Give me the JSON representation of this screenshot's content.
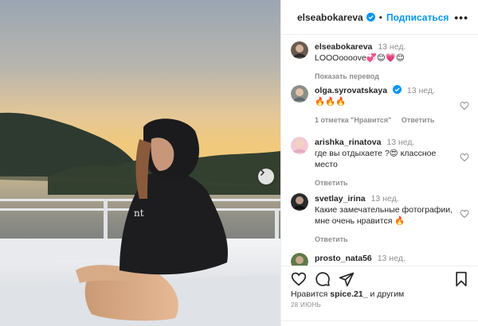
{
  "post": {
    "author": "elseabokareva",
    "follow_label": "Подписаться",
    "dot": "•",
    "more": "•••"
  },
  "comments": [
    {
      "user": "elseabokareva",
      "time": "13 нед.",
      "text": "LOOOoooove💞😊💗😊",
      "meta": [
        "Показать перевод"
      ],
      "verified": false
    },
    {
      "user": "olga.syrovatskaya",
      "time": "13 нед.",
      "text": "🔥🔥🔥",
      "meta": [
        "1 отметка \"Нравится\"",
        "Ответить"
      ],
      "verified": true
    },
    {
      "user": "arishka_rinatova",
      "time": "13 нед.",
      "text": "где вы отдыхаете ?😍 классное место",
      "meta": [
        "Ответить"
      ],
      "verified": false
    },
    {
      "user": "svetlay_irina",
      "time": "13 нед.",
      "text": "Какие замечательные фотографии, мне очень нравится 🔥",
      "meta": [
        "Ответить"
      ],
      "verified": false
    },
    {
      "user": "prosto_nata56",
      "time": "13 нед.",
      "text": "",
      "meta": [],
      "verified": false
    }
  ],
  "likes": {
    "prefix": "Нравится",
    "user": "spice.21_",
    "suffix": "и другим"
  },
  "date": "28 июнь",
  "colors": {
    "accent": "#0095f6",
    "muted": "#8e8e8e",
    "text": "#262626"
  },
  "icons": [
    "heart-icon",
    "comment-icon",
    "share-icon",
    "bookmark-icon",
    "chevron-right-icon",
    "verified-icon"
  ]
}
